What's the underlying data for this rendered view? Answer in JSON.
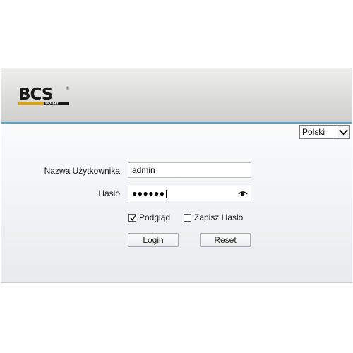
{
  "brand": {
    "logo_text": "BCS",
    "logo_subtext": "POINT",
    "logo_mark": "®",
    "accent_color": "#4aa9d8",
    "logo_color": "#1a1a1a",
    "logo_stripe_color": "#d9a21b"
  },
  "language": {
    "selected": "Polski"
  },
  "form": {
    "username_label": "Nazwa Użytkownika",
    "username_value": "admin",
    "password_label": "Hasło",
    "password_value": "●●●●●●",
    "preview_label": "Podgląd",
    "preview_checked": true,
    "save_password_label": "Zapisz Hasło",
    "save_password_checked": false
  },
  "buttons": {
    "login_label": "Login",
    "reset_label": "Reset"
  },
  "icons": {
    "password_toggle": "eye-icon",
    "dropdown": "chevron-down-icon",
    "checkmark": "check-icon"
  }
}
